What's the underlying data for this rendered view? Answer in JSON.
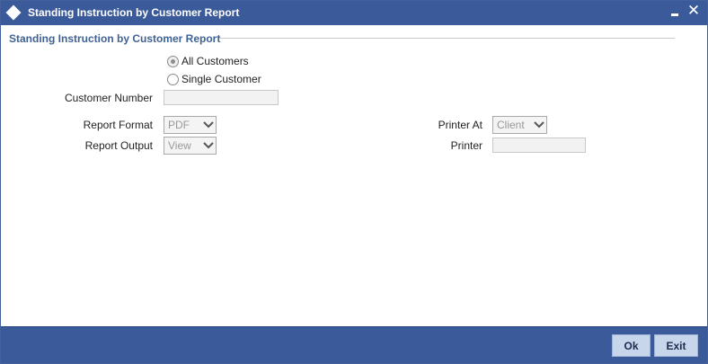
{
  "window": {
    "title": "Standing Instruction by Customer Report",
    "minimize_icon": "minimize-icon",
    "close_glyph": "✕"
  },
  "section": {
    "title": "Standing Instruction by Customer Report"
  },
  "customer_scope": {
    "options": [
      {
        "label": "All Customers",
        "selected": true
      },
      {
        "label": "Single Customer",
        "selected": false
      }
    ]
  },
  "customer_number": {
    "label": "Customer Number",
    "value": ""
  },
  "report_format": {
    "label": "Report Format",
    "value": "PDF"
  },
  "report_output": {
    "label": "Report Output",
    "value": "View"
  },
  "printer_at": {
    "label": "Printer At",
    "value": "Client"
  },
  "printer": {
    "label": "Printer",
    "value": ""
  },
  "footer": {
    "ok_label": "Ok",
    "exit_label": "Exit"
  },
  "colors": {
    "titlebar": "#3b5a9a",
    "section_title": "#3f6294",
    "button_bg": "#c8d6ec"
  }
}
